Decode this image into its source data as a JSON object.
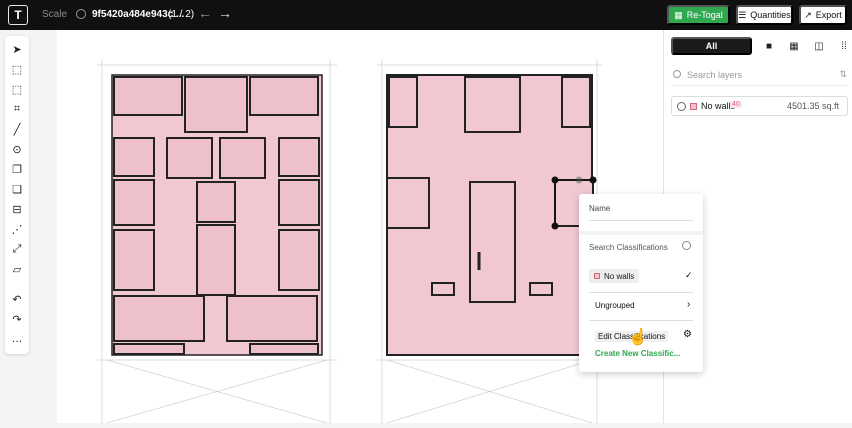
{
  "topbar": {
    "logo": "T",
    "scale_label": "Scale",
    "file_name": "9f5420a484e943c ...",
    "page_indicator": "(1 / 2)",
    "retogal_label": "Re-Togal",
    "quantities_label": "Quantities",
    "export_label": "Export"
  },
  "toolbar": {
    "icons": [
      "select-arrow-icon",
      "rectangle-icon",
      "polygon-icon",
      "crop-icon",
      "line-icon",
      "circle-icon",
      "copy-icon",
      "merge-icon",
      "segment-icon",
      "polyline-icon",
      "path-icon",
      "ruler-icon",
      "undo-icon",
      "redo-icon",
      "more-icon"
    ],
    "more_label": "…"
  },
  "panel": {
    "tab_all": "All",
    "search_placeholder": "Search layers",
    "layer": {
      "name": "No walls",
      "count": "40",
      "area": "4501.35 sq.ft"
    }
  },
  "popup": {
    "name_label": "Name",
    "search_placeholder": "Search Classifications",
    "chip_label": "No walls",
    "ungrouped_label": "Ungrouped",
    "edit_label": "Edit Classifications",
    "create_label": "Create New Classific..."
  },
  "colors": {
    "accent_green": "#2fa84f",
    "fill_pink": "#f1c8d1",
    "topbar_bg": "#101010"
  }
}
